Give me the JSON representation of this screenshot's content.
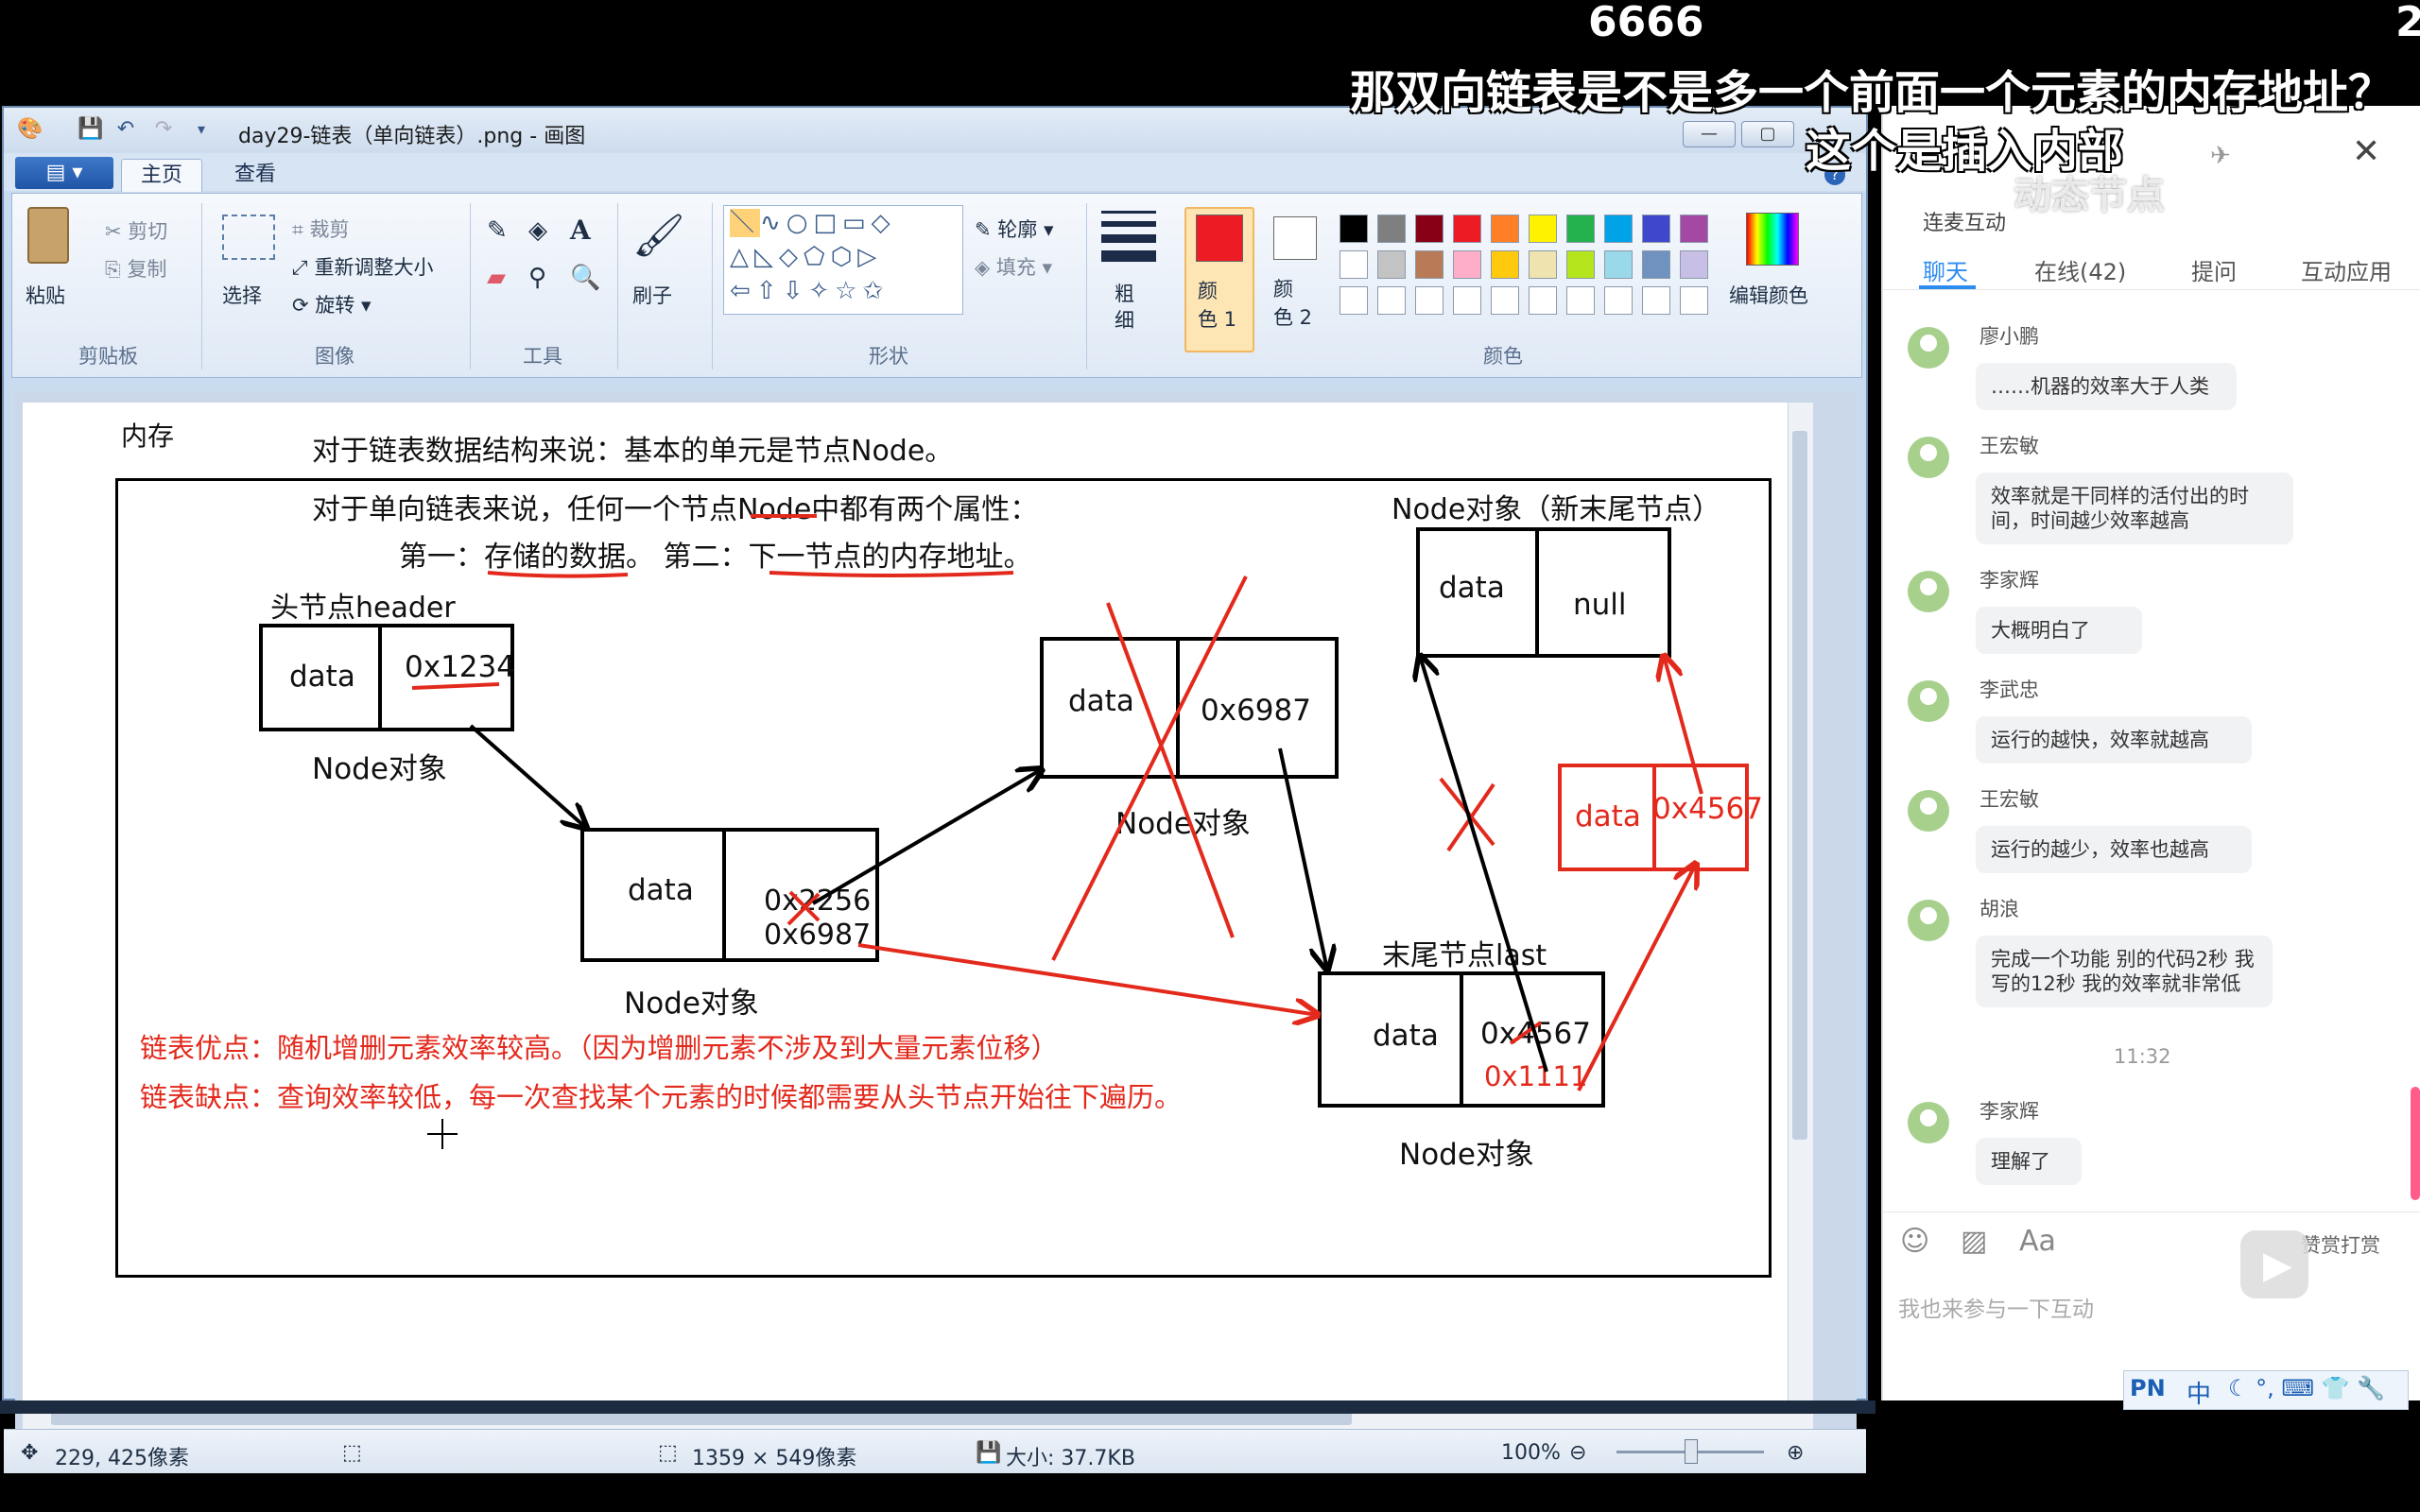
{
  "danmaku": [
    "6666",
    "那双向链表是不是多一个前面一个元素的内存地址？",
    "这个是插入内部",
    "2"
  ],
  "paint": {
    "title": "day29-链表（单向链表）.png - 画图",
    "tabs": [
      "主页",
      "查看"
    ],
    "clipboard": {
      "paste": "粘贴",
      "cut": "剪切",
      "copy": "复制",
      "group": "剪贴板"
    },
    "image": {
      "select": "选择",
      "crop": "裁剪",
      "resize": "重新调整大小",
      "rotate": "旋转",
      "group": "图像"
    },
    "tools_group": "工具",
    "brush": "刷子",
    "shapes": {
      "outline": "轮廓",
      "fill": "填充",
      "group": "形状"
    },
    "size": "粗\n细",
    "color1": "颜\n色 1",
    "color2": "颜\n色 2",
    "edit_colors": "编辑颜色",
    "colors_group": "颜色",
    "palette_row1": [
      "#000000",
      "#7f7f7f",
      "#880015",
      "#ed1c24",
      "#ff7f27",
      "#fff200",
      "#22b14c",
      "#00a2e8",
      "#3f48cc",
      "#a349a4"
    ],
    "palette_row2": [
      "#ffffff",
      "#c3c3c3",
      "#b97a57",
      "#ffaec9",
      "#ffc90e",
      "#efe4b0",
      "#b5e61d",
      "#99d9ea",
      "#7092be",
      "#c8bfe7"
    ],
    "color1_value": "#ed1c24",
    "color2_value": "#ffffff",
    "status": {
      "cursor": "229, 425像素",
      "dimensions": "1359 × 549像素",
      "size": "大小: 37.7KB",
      "zoom": "100%"
    }
  },
  "drawing": {
    "memory": "内存",
    "line1": "对于链表数据结构来说：基本的单元是节点Node。",
    "line2": "对于单向链表来说，任何一个节点Node中都有两个属性：",
    "line3": "第一：存储的数据。 第二：下一节点的内存地址。",
    "header_label": "头节点header",
    "node_obj": "Node对象",
    "data": "data",
    "addr1": "0x1234",
    "addr2_old": "0x2256",
    "addr2_new": "0x6987",
    "addr3": "0x6987",
    "new_tail_label": "Node对象（新末尾节点）",
    "null": "null",
    "new_addr": "0x4567",
    "tail_label": "末尾节点last",
    "tail_addr": "0x4567",
    "tail_addr_old": "0x1111",
    "pro": "链表优点：随机增删元素效率较高。（因为增删元素不涉及到大量元素位移）",
    "con": "链表缺点：查询效率较低，每一次查找某个元素的时候都需要从头节点开始往下遍历。"
  },
  "chat": {
    "title": "连麦互动",
    "overlay_text": "动态节点",
    "tabs": [
      "聊天",
      "在线(42)",
      "提问",
      "互动应用"
    ],
    "messages": [
      {
        "name": "廖小鹏",
        "text": "……机器的效率大于人类"
      },
      {
        "name": "王宏敏",
        "text": "效率就是干同样的活付出的时间，时间越少效率越高"
      },
      {
        "name": "李家辉",
        "text": "大概明白了"
      },
      {
        "name": "李武忠",
        "text": "运行的越快，效率就越高"
      },
      {
        "name": "王宏敏",
        "text": "运行的越少，效率也越高"
      },
      {
        "name": "胡浪",
        "text": "完成一个功能 别的代码2秒 我写的12秒 我的效率就非常低"
      },
      {
        "name": "李家辉",
        "text": "理解了"
      }
    ],
    "time": "11:32",
    "tip_label": "赞赏打赏",
    "input_placeholder": "我也来参与一下互动",
    "ime": "中"
  }
}
